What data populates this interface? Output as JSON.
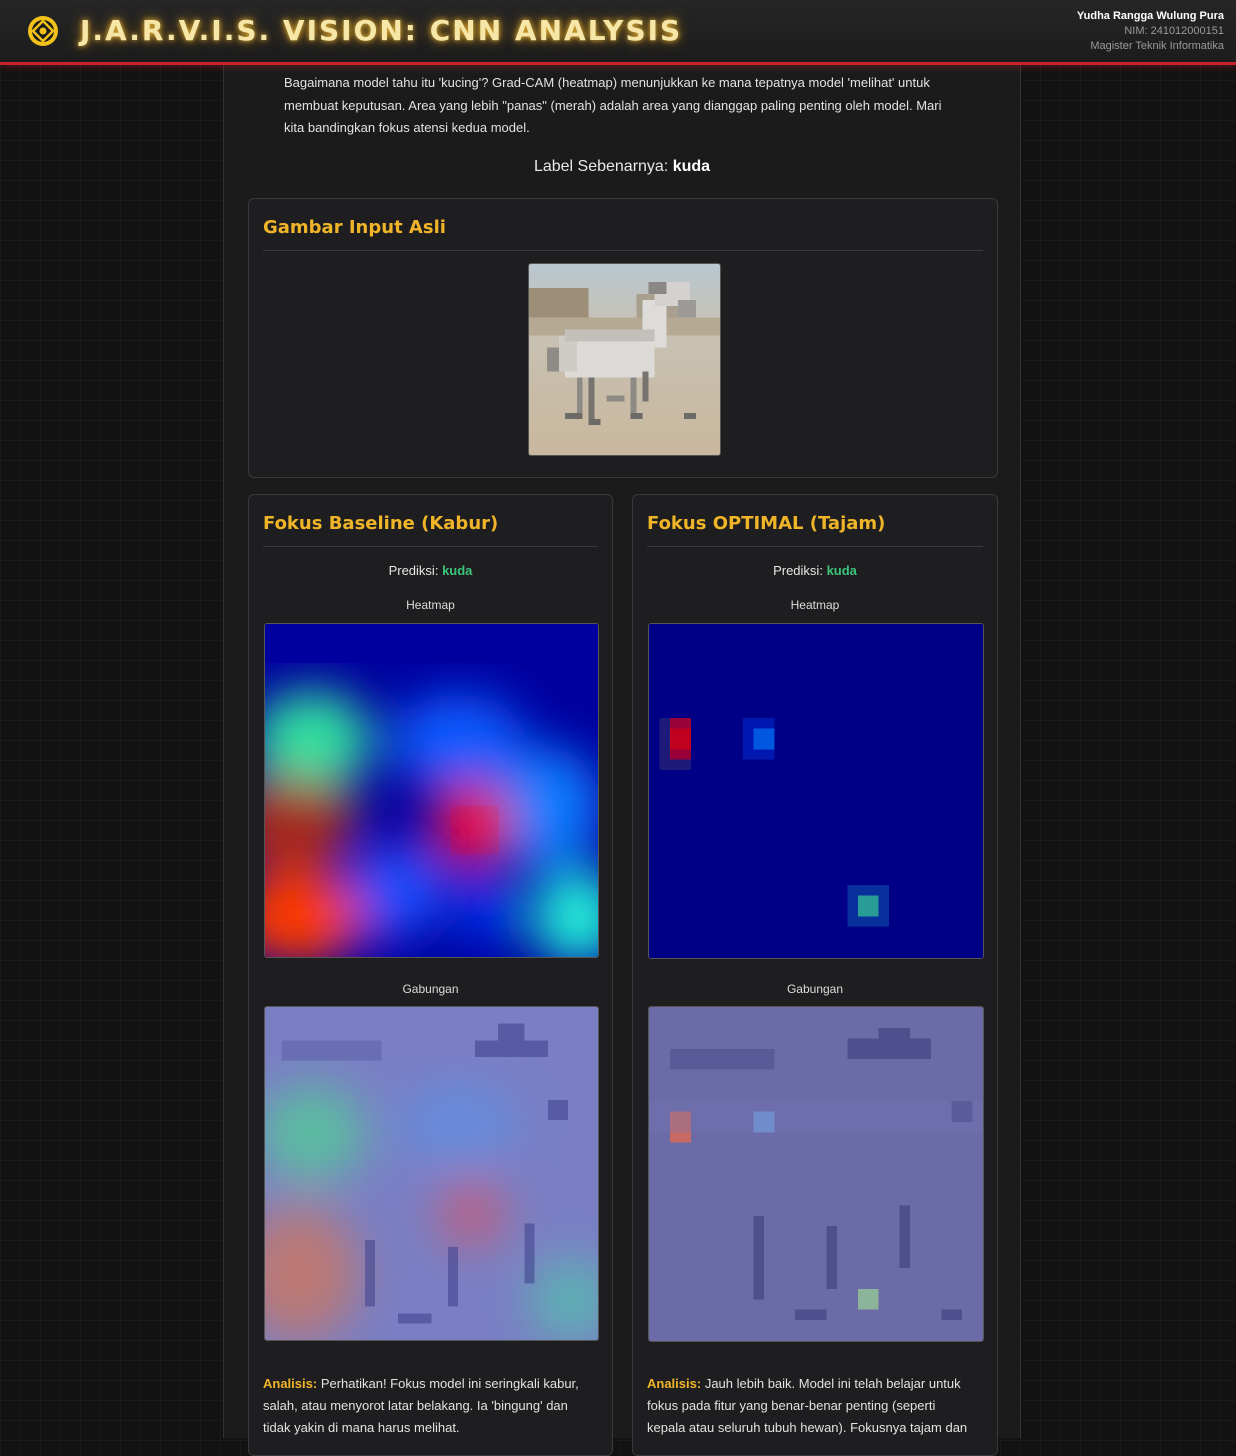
{
  "header": {
    "title": "J.A.R.V.I.S. VISION: CNN ANALYSIS",
    "user_name": "Yudha Rangga Wulung Pura",
    "nim": "NIM: 241012000151",
    "program": "Magister Teknik Informatika"
  },
  "intro": {
    "text": "Bagaimana model tahu itu 'kucing'? Grad-CAM (heatmap) menunjukkan ke mana tepatnya model 'melihat' untuk membuat keputusan. Area yang lebih \"panas\" (merah) adalah area yang dianggap paling penting oleh model. Mari kita bandingkan fokus atensi kedua model.",
    "label_prefix": "Label Sebenarnya:",
    "label_value": "kuda"
  },
  "input_card": {
    "title": "Gambar Input Asli"
  },
  "baseline": {
    "title": "Fokus Baseline (Kabur)",
    "pred_prefix": "Prediksi:",
    "pred_value": "kuda",
    "heatmap_label": "Heatmap",
    "overlay_label": "Gabungan",
    "analysis_label": "Analisis:",
    "analysis_text": "Perhatikan! Fokus model ini seringkali kabur, salah, atau menyorot latar belakang. Ia 'bingung' dan tidak yakin di mana harus melihat."
  },
  "optimal": {
    "title": "Fokus OPTIMAL (Tajam)",
    "pred_prefix": "Prediksi:",
    "pred_value": "kuda",
    "heatmap_label": "Heatmap",
    "overlay_label": "Gabungan",
    "analysis_label": "Analisis:",
    "analysis_text": "Jauh lebih baik. Model ini telah belajar untuk fokus pada fitur yang benar-benar penting (seperti kepala atau seluruh tubuh hewan). Fokusnya tajam dan"
  },
  "colors": {
    "accent": "#f0b429",
    "header_border": "#c8232c",
    "prediction": "#3cc47c"
  }
}
